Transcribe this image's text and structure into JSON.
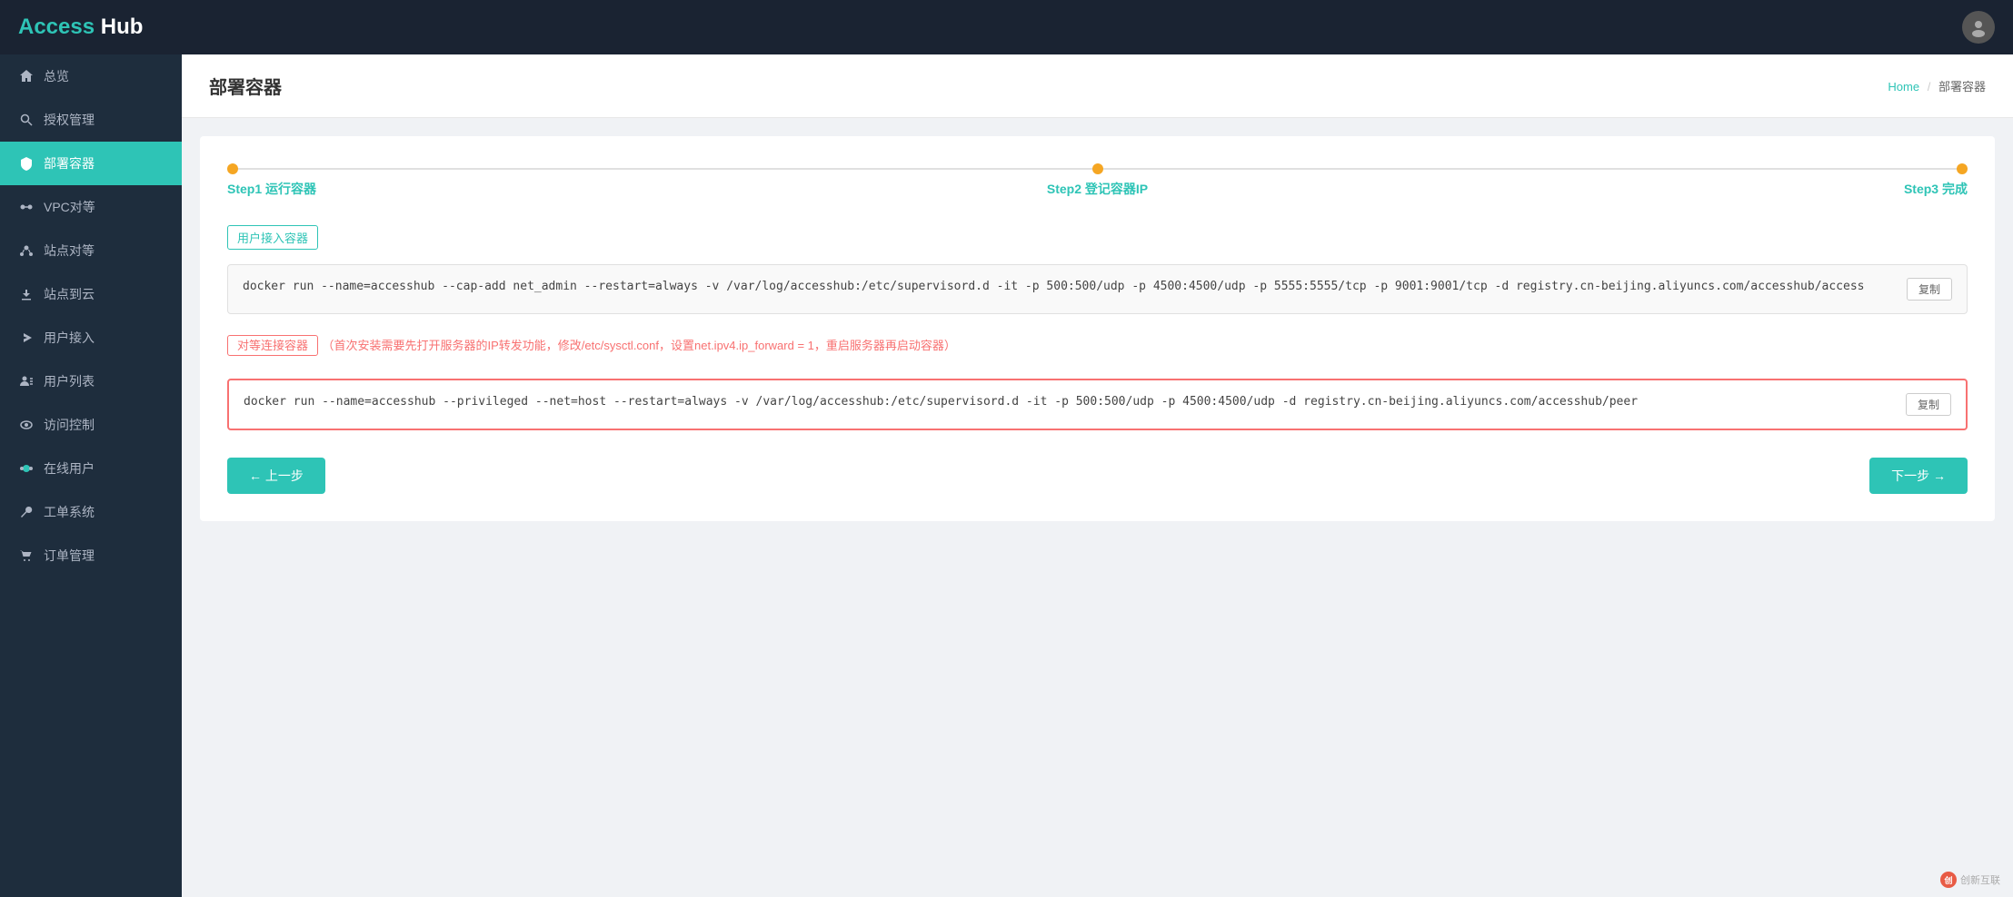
{
  "header": {
    "logo_access": "Access",
    "logo_hub": " Hub",
    "user_icon": "👤"
  },
  "sidebar": {
    "items": [
      {
        "id": "dashboard",
        "label": "总览",
        "icon": "⌂",
        "active": false
      },
      {
        "id": "auth-mgmt",
        "label": "授权管理",
        "icon": "🔍",
        "active": false
      },
      {
        "id": "deploy-container",
        "label": "部署容器",
        "icon": "🛡",
        "active": true
      },
      {
        "id": "vpc-peer",
        "label": "VPC对等",
        "icon": "⚙",
        "active": false
      },
      {
        "id": "site-peer",
        "label": "站点对等",
        "icon": "👥",
        "active": false
      },
      {
        "id": "site-to-cloud",
        "label": "站点到云",
        "icon": "⬇",
        "active": false
      },
      {
        "id": "user-access",
        "label": "用户接入",
        "icon": "✈",
        "active": false
      },
      {
        "id": "user-list",
        "label": "用户列表",
        "icon": "👤",
        "active": false
      },
      {
        "id": "access-control",
        "label": "访问控制",
        "icon": "👁",
        "active": false
      },
      {
        "id": "online-users",
        "label": "在线用户",
        "icon": "🟢",
        "active": false
      },
      {
        "id": "ticket-system",
        "label": "工单系统",
        "icon": "🔧",
        "active": false
      },
      {
        "id": "order-mgmt",
        "label": "订单管理",
        "icon": "🛒",
        "active": false
      }
    ]
  },
  "page": {
    "title": "部署容器",
    "breadcrumb_home": "Home",
    "breadcrumb_sep": "/",
    "breadcrumb_current": "部署容器"
  },
  "steps": [
    {
      "id": "step1",
      "label": "Step1 运行容器",
      "active": true
    },
    {
      "id": "step2",
      "label": "Step2 登记容器IP",
      "active": true
    },
    {
      "id": "step3",
      "label": "Step3 完成",
      "active": true
    }
  ],
  "user_container": {
    "tag_label": "用户接入容器",
    "command": "docker run --name=accesshub --cap-add net_admin --restart=always -v /var/log/accesshub:/etc/supervisord.d -it -p 500:500/udp -p 4500:4500/udp -p 5555:5555/tcp -p 9001:9001/tcp -d registry.cn-beijing.aliyuncs.com/accesshub/access",
    "copy_btn": "复制"
  },
  "peer_container": {
    "tag_label": "对等连接容器",
    "notice": "（首次安装需要先打开服务器的IP转发功能，修改/etc/sysctl.conf，设置net.ipv4.ip_forward = 1，重启服务器再启动容器）",
    "command": "docker run --name=accesshub --privileged --net=host --restart=always -v /var/log/accesshub:/etc/supervisord.d -it -p 500:500/udp -p 4500:4500/udp -d registry.cn-beijing.aliyuncs.com/accesshub/peer",
    "copy_btn": "复制"
  },
  "buttons": {
    "prev": "← 上一步",
    "next": "下一步 →"
  },
  "watermark": {
    "icon": "创",
    "text": "创新互联"
  }
}
